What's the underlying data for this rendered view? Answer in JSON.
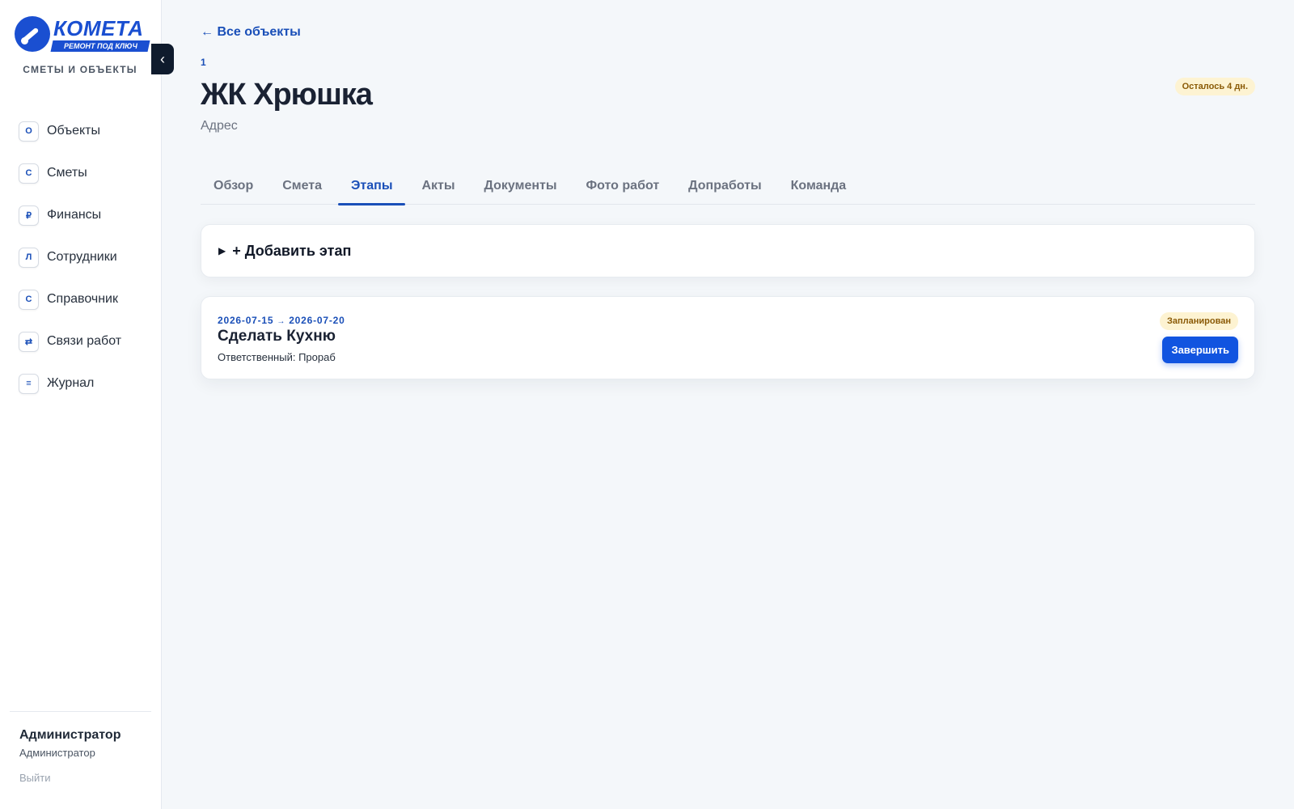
{
  "brand": {
    "logo_text": "КОМЕТА",
    "logo_tagline": "РЕМОНТ ПОД КЛЮЧ",
    "app_subtitle": "СМЕТЫ И ОБЪЕКТЫ",
    "accent_color": "#1a4fd1"
  },
  "sidebar": {
    "collapse_icon": "‹",
    "items": [
      {
        "icon": "О",
        "label": "Объекты"
      },
      {
        "icon": "С",
        "label": "Сметы"
      },
      {
        "icon": "₽",
        "label": "Финансы"
      },
      {
        "icon": "Л",
        "label": "Сотрудники"
      },
      {
        "icon": "С",
        "label": "Справочник"
      },
      {
        "icon": "⇄",
        "label": "Связи работ"
      },
      {
        "icon": "≡",
        "label": "Журнал"
      }
    ],
    "user": {
      "name": "Администратор",
      "role": "Администратор",
      "logout_label": "Выйти"
    }
  },
  "header": {
    "back_label": "← Все объекты",
    "object_id": "1",
    "title": "ЖК Хрюшка",
    "address": "Адрес",
    "days_left_badge": "Осталось 4 дн."
  },
  "tabs": [
    {
      "label": "Обзор",
      "active": false
    },
    {
      "label": "Смета",
      "active": false
    },
    {
      "label": "Этапы",
      "active": true
    },
    {
      "label": "Акты",
      "active": false
    },
    {
      "label": "Документы",
      "active": false
    },
    {
      "label": "Фото работ",
      "active": false
    },
    {
      "label": "Допработы",
      "active": false
    },
    {
      "label": "Команда",
      "active": false
    }
  ],
  "add_stage": {
    "toggle_icon": "▶",
    "label": "+ Добавить этап"
  },
  "stages": [
    {
      "start_date": "2026-07-15",
      "arrow": "→",
      "end_date": "2026-07-20",
      "title": "Сделать Кухню",
      "responsible": "Ответственный: Прораб",
      "status": "Запланирован",
      "action_label": "Завершить"
    }
  ]
}
